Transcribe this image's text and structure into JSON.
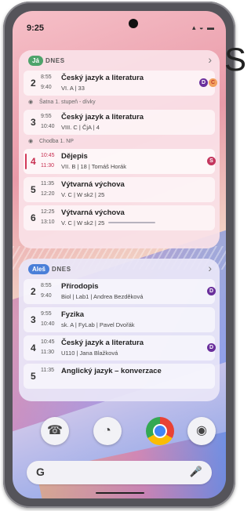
{
  "status": {
    "time": "9:25",
    "icons": "⁠.ıl ᯤ ▬"
  },
  "edge_letter": "S",
  "widget1": {
    "chip": "Já",
    "header": "DNES",
    "rows": [
      {
        "num": "2",
        "start": "8:55",
        "end": "9:40",
        "subject": "Český jazyk a literatura",
        "info": "VI. A | 33",
        "badges": [
          "D",
          "C"
        ]
      },
      {
        "sep": "Šatna 1. stupeň - dívky"
      },
      {
        "num": "3",
        "start": "9:55",
        "end": "10:40",
        "subject": "Český jazyk a literatura",
        "info": "VIII. C | ČjA | 4"
      },
      {
        "sep": "Chodba 1. NP"
      },
      {
        "num": "4",
        "start": "10:45",
        "end": "11:30",
        "subject": "Dějepis",
        "info": "VII. B | 18 | Tomáš Horák",
        "badges": [
          "S"
        ],
        "current": true
      },
      {
        "num": "5",
        "start": "11:35",
        "end": "12:20",
        "subject": "Výtvarná výchova",
        "info": "V. C | W sk2 | 25"
      },
      {
        "num": "6",
        "start": "12:25",
        "end": "13:10",
        "subject": "Výtvarná výchova",
        "info": "V. C | W sk2 | 25"
      }
    ]
  },
  "widget2": {
    "chip": "Aleš",
    "header": "DNES",
    "rows": [
      {
        "num": "2",
        "start": "8:55",
        "end": "9:40",
        "subject": "Přírodopis",
        "info": "Biol | Lab1 | Andrea Bezděková",
        "badges": [
          "D"
        ]
      },
      {
        "num": "3",
        "start": "9:55",
        "end": "10:40",
        "subject": "Fyzika",
        "info": "sk. A | FyLab | Pavel Dvořák"
      },
      {
        "num": "4",
        "start": "10:45",
        "end": "11:30",
        "subject": "Český jazyk a literatura",
        "info": "U110 | Jana Blažková",
        "badges": [
          "D"
        ]
      },
      {
        "num": "5",
        "start": "11:35",
        "end": "",
        "subject": "Anglický jazyk – konverzace",
        "info": ""
      }
    ]
  },
  "dock": {
    "phone": "☎",
    "clock": "◔",
    "camera": "◉"
  },
  "search": {
    "g": "G",
    "mic": "🎙"
  }
}
